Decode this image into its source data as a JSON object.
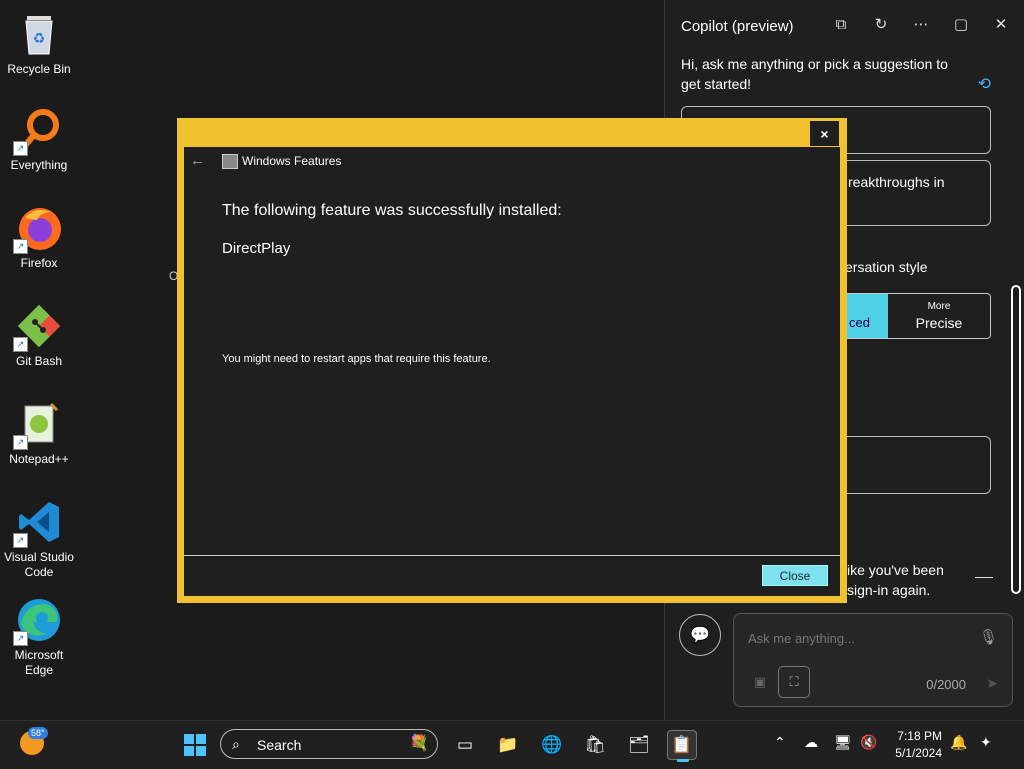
{
  "desktop": {
    "icons": [
      {
        "label": "Recycle Bin"
      },
      {
        "label": "Everything"
      },
      {
        "label": "Firefox"
      },
      {
        "label": "Git Bash"
      },
      {
        "label": "Notepad++"
      },
      {
        "label": "Visual Studio Code"
      },
      {
        "label": "Microsoft Edge"
      }
    ]
  },
  "copilot": {
    "title": "Copilot (preview)",
    "greeting": "Hi, ask me anything or pick a suggestion to get started!",
    "suggestion_fragment": "reakthroughs in",
    "style_label": "ersation style",
    "balanced_fragment": "ced",
    "precise_more": "More",
    "precise_label": "Precise",
    "signin_line1": "ike you've been",
    "signin_line2": "sign-in again.",
    "input_placeholder": "Ask me anything...",
    "counter": "0/2000"
  },
  "background_fragment": "O",
  "dialog": {
    "title": "Windows Features",
    "message": "The following feature was successfully installed:",
    "feature": "DirectPlay",
    "note": "You might need to restart apps that require this feature.",
    "close_label": "Close",
    "x_label": "×"
  },
  "taskbar": {
    "weather_temp": "58°",
    "search_label": "Search",
    "time": "7:18 PM",
    "date": "5/1/2024"
  },
  "colors": {
    "dialog_border": "#f0c22f",
    "accent": "#4cc2ff",
    "close_button": "#7fe1ee"
  }
}
